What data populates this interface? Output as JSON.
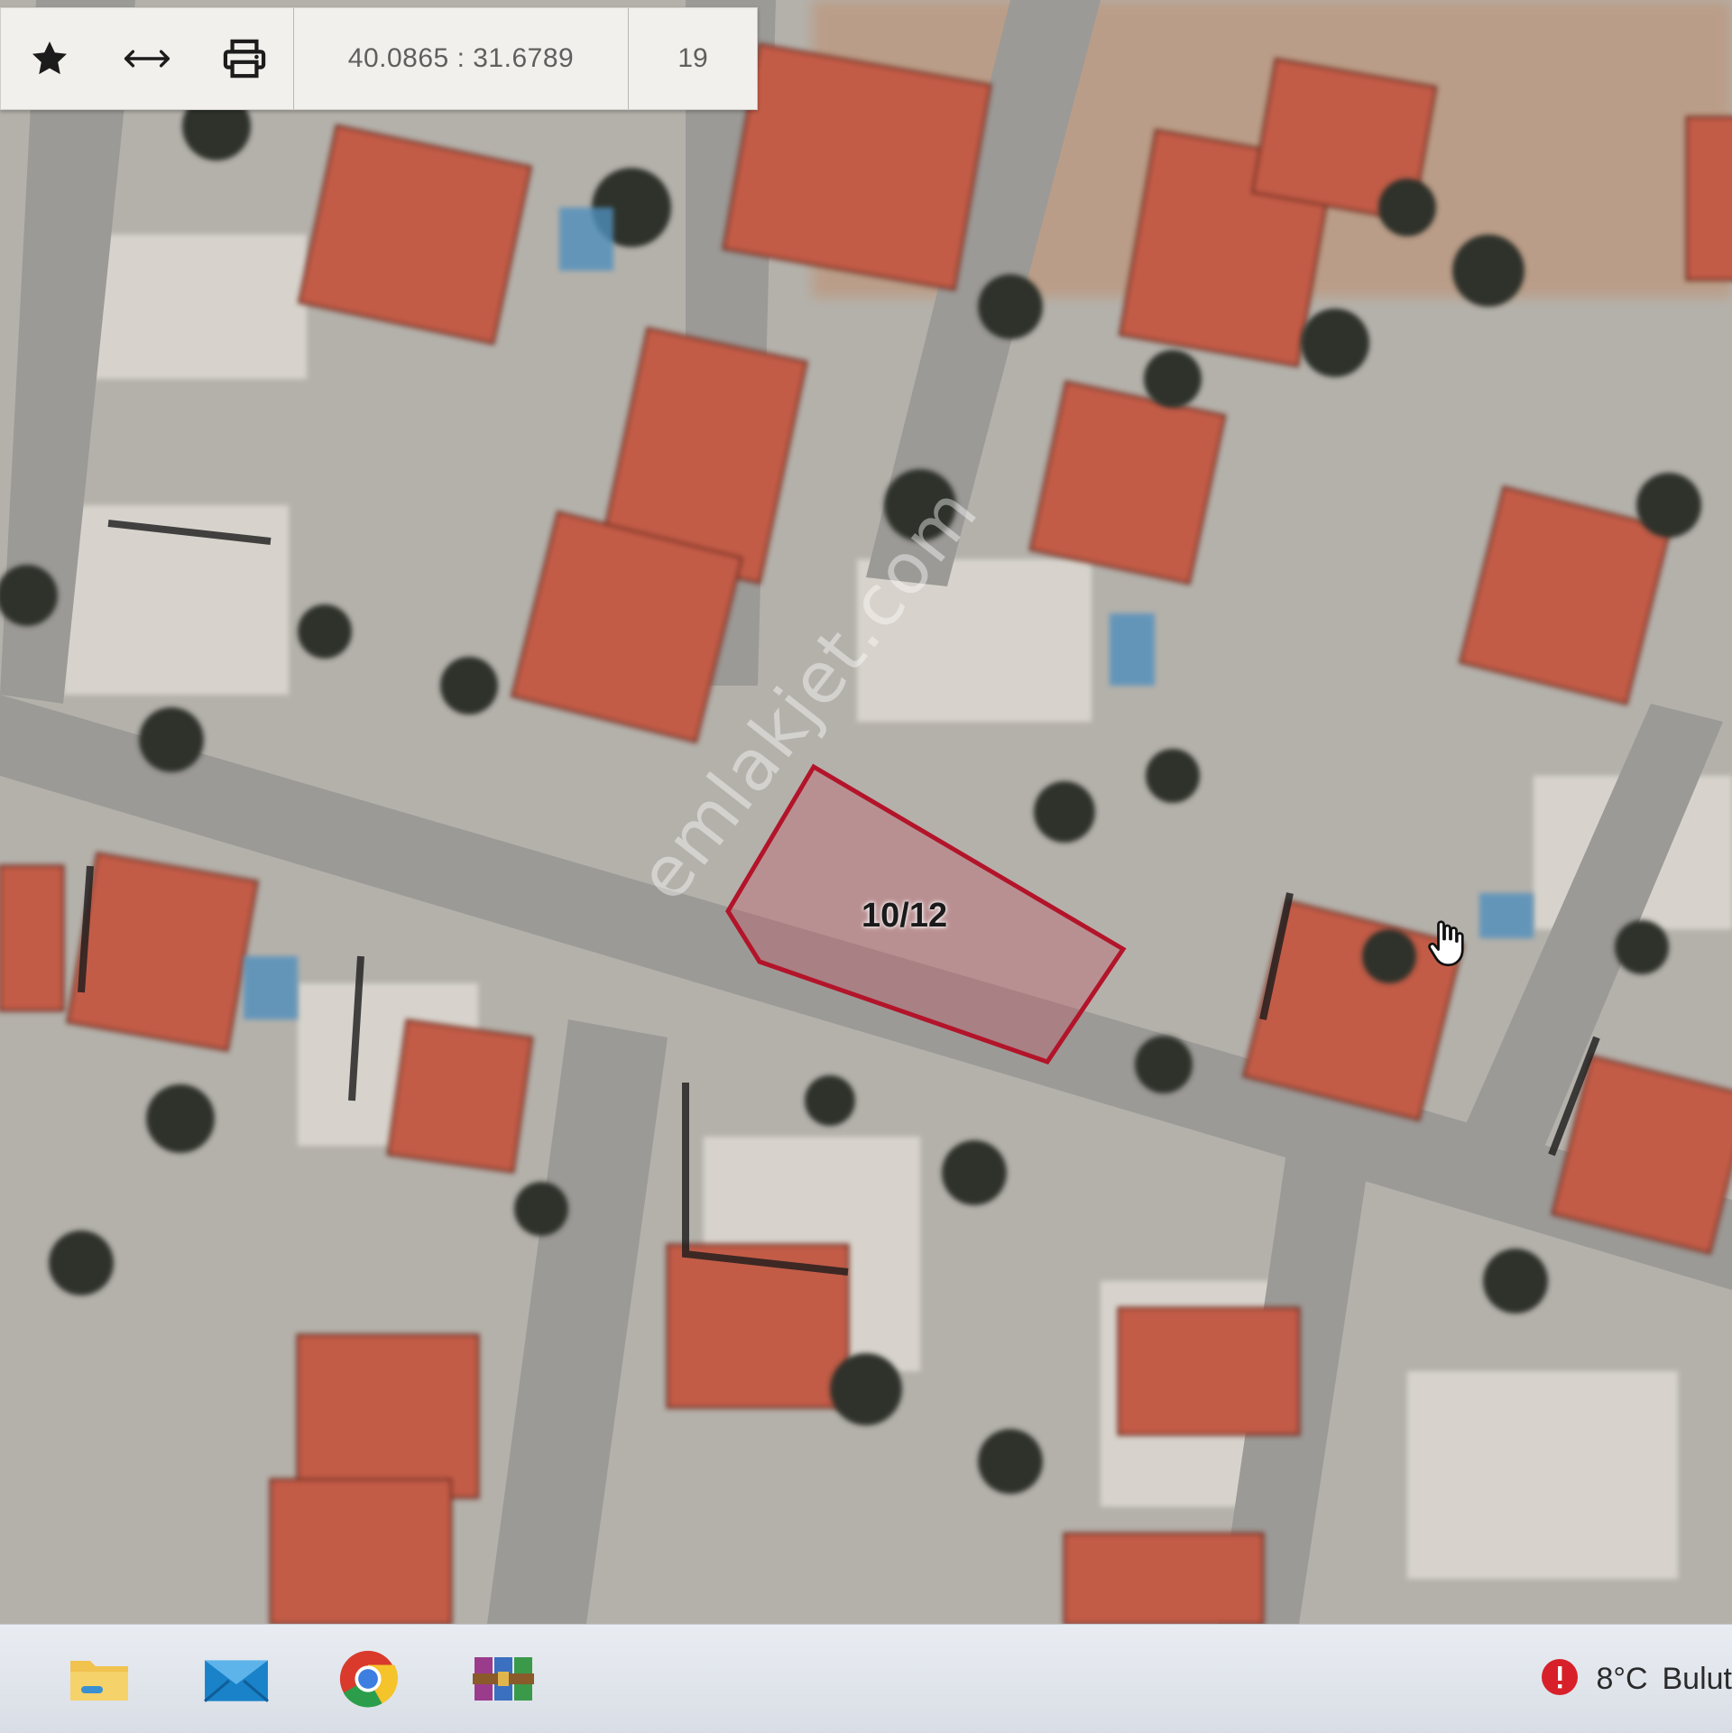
{
  "toolbar": {
    "buttons": [
      {
        "name": "favorite",
        "icon": "star-icon"
      },
      {
        "name": "measure",
        "icon": "arrow-horizontal-icon"
      },
      {
        "name": "print",
        "icon": "printer-icon"
      }
    ],
    "coordinates": "40.0865 : 31.6789",
    "zoom_level": "19"
  },
  "parcel": {
    "label": "10/12",
    "outline_color": "#b3142a"
  },
  "watermark": "emlakjet.com",
  "taskbar": {
    "apps": [
      {
        "name": "file-explorer",
        "icon": "folder-icon"
      },
      {
        "name": "mail",
        "icon": "mail-icon"
      },
      {
        "name": "chrome",
        "icon": "chrome-icon"
      },
      {
        "name": "winrar",
        "icon": "archive-icon"
      }
    ],
    "weather": {
      "temperature": "8°C",
      "description": "Bulut"
    }
  }
}
